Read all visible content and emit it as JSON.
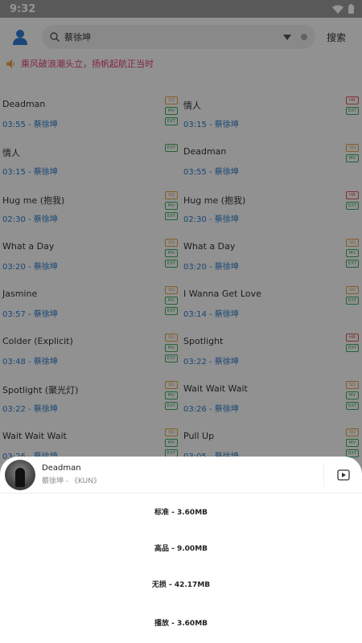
{
  "status_bar": {
    "time": "9:32"
  },
  "search": {
    "query": "蔡徐坤",
    "button": "搜索"
  },
  "notice": {
    "text": "乘风破浪潮头立，扬帆起航正当时"
  },
  "songs": [
    {
      "title": "Deadman",
      "meta": "03:55 - 蔡徐坤",
      "badges": [
        "SQ",
        "MV",
        "EXT"
      ]
    },
    {
      "title": "情人",
      "meta": "03:15 - 蔡徐坤",
      "badges": [
        "HR",
        "EXT"
      ]
    },
    {
      "title": "情人",
      "meta": "03:15 - 蔡徐坤",
      "badges": [
        "EXT"
      ]
    },
    {
      "title": "Deadman",
      "meta": "03:55 - 蔡徐坤",
      "badges": [
        "SQ",
        "MV"
      ]
    },
    {
      "title": "Hug me (抱我)",
      "meta": "02:30 - 蔡徐坤",
      "badges": [
        "SQ",
        "MV",
        "EXT"
      ]
    },
    {
      "title": "Hug me (抱我)",
      "meta": "02:30 - 蔡徐坤",
      "badges": [
        "HR",
        "EXT"
      ]
    },
    {
      "title": "What a Day",
      "meta": "03:20 - 蔡徐坤",
      "badges": [
        "SQ",
        "MV",
        "EXT"
      ]
    },
    {
      "title": "What a Day",
      "meta": "03:20 - 蔡徐坤",
      "badges": [
        "SQ",
        "MV",
        "EXT"
      ]
    },
    {
      "title": "Jasmine",
      "meta": "03:57 - 蔡徐坤",
      "badges": [
        "SQ",
        "MV",
        "EXT"
      ]
    },
    {
      "title": "I Wanna Get Love",
      "meta": "03:14 - 蔡徐坤",
      "badges": [
        "SQ",
        "EXT"
      ]
    },
    {
      "title": "Colder (Explicit)",
      "meta": "03:48 - 蔡徐坤",
      "badges": [
        "SQ",
        "MV",
        "EXT"
      ]
    },
    {
      "title": "Spotlight",
      "meta": "03:22 - 蔡徐坤",
      "badges": [
        "HR",
        "EXT"
      ]
    },
    {
      "title": "Spotlight (聚光灯)",
      "meta": "03:22 - 蔡徐坤",
      "badges": [
        "SQ",
        "MV",
        "EXT"
      ]
    },
    {
      "title": "Wait Wait Wait",
      "meta": "03:26 - 蔡徐坤",
      "badges": [
        "SQ",
        "MV",
        "EXT"
      ]
    },
    {
      "title": "Wait Wait Wait",
      "meta": "03:26 - 蔡徐坤",
      "badges": [
        "SQ",
        "MV",
        "EXT"
      ]
    },
    {
      "title": "Pull Up",
      "meta": "03:05 - 蔡徐坤",
      "badges": [
        "SQ",
        "MV",
        "EXT"
      ]
    }
  ],
  "sheet": {
    "song_name": "Deadman",
    "song_sub": "蔡徐坤 - 《KUN》",
    "options": [
      "标准 - 3.60MB",
      "高品 - 9.00MB",
      "无损 - 42.17MB",
      "播放 - 3.60MB"
    ]
  }
}
